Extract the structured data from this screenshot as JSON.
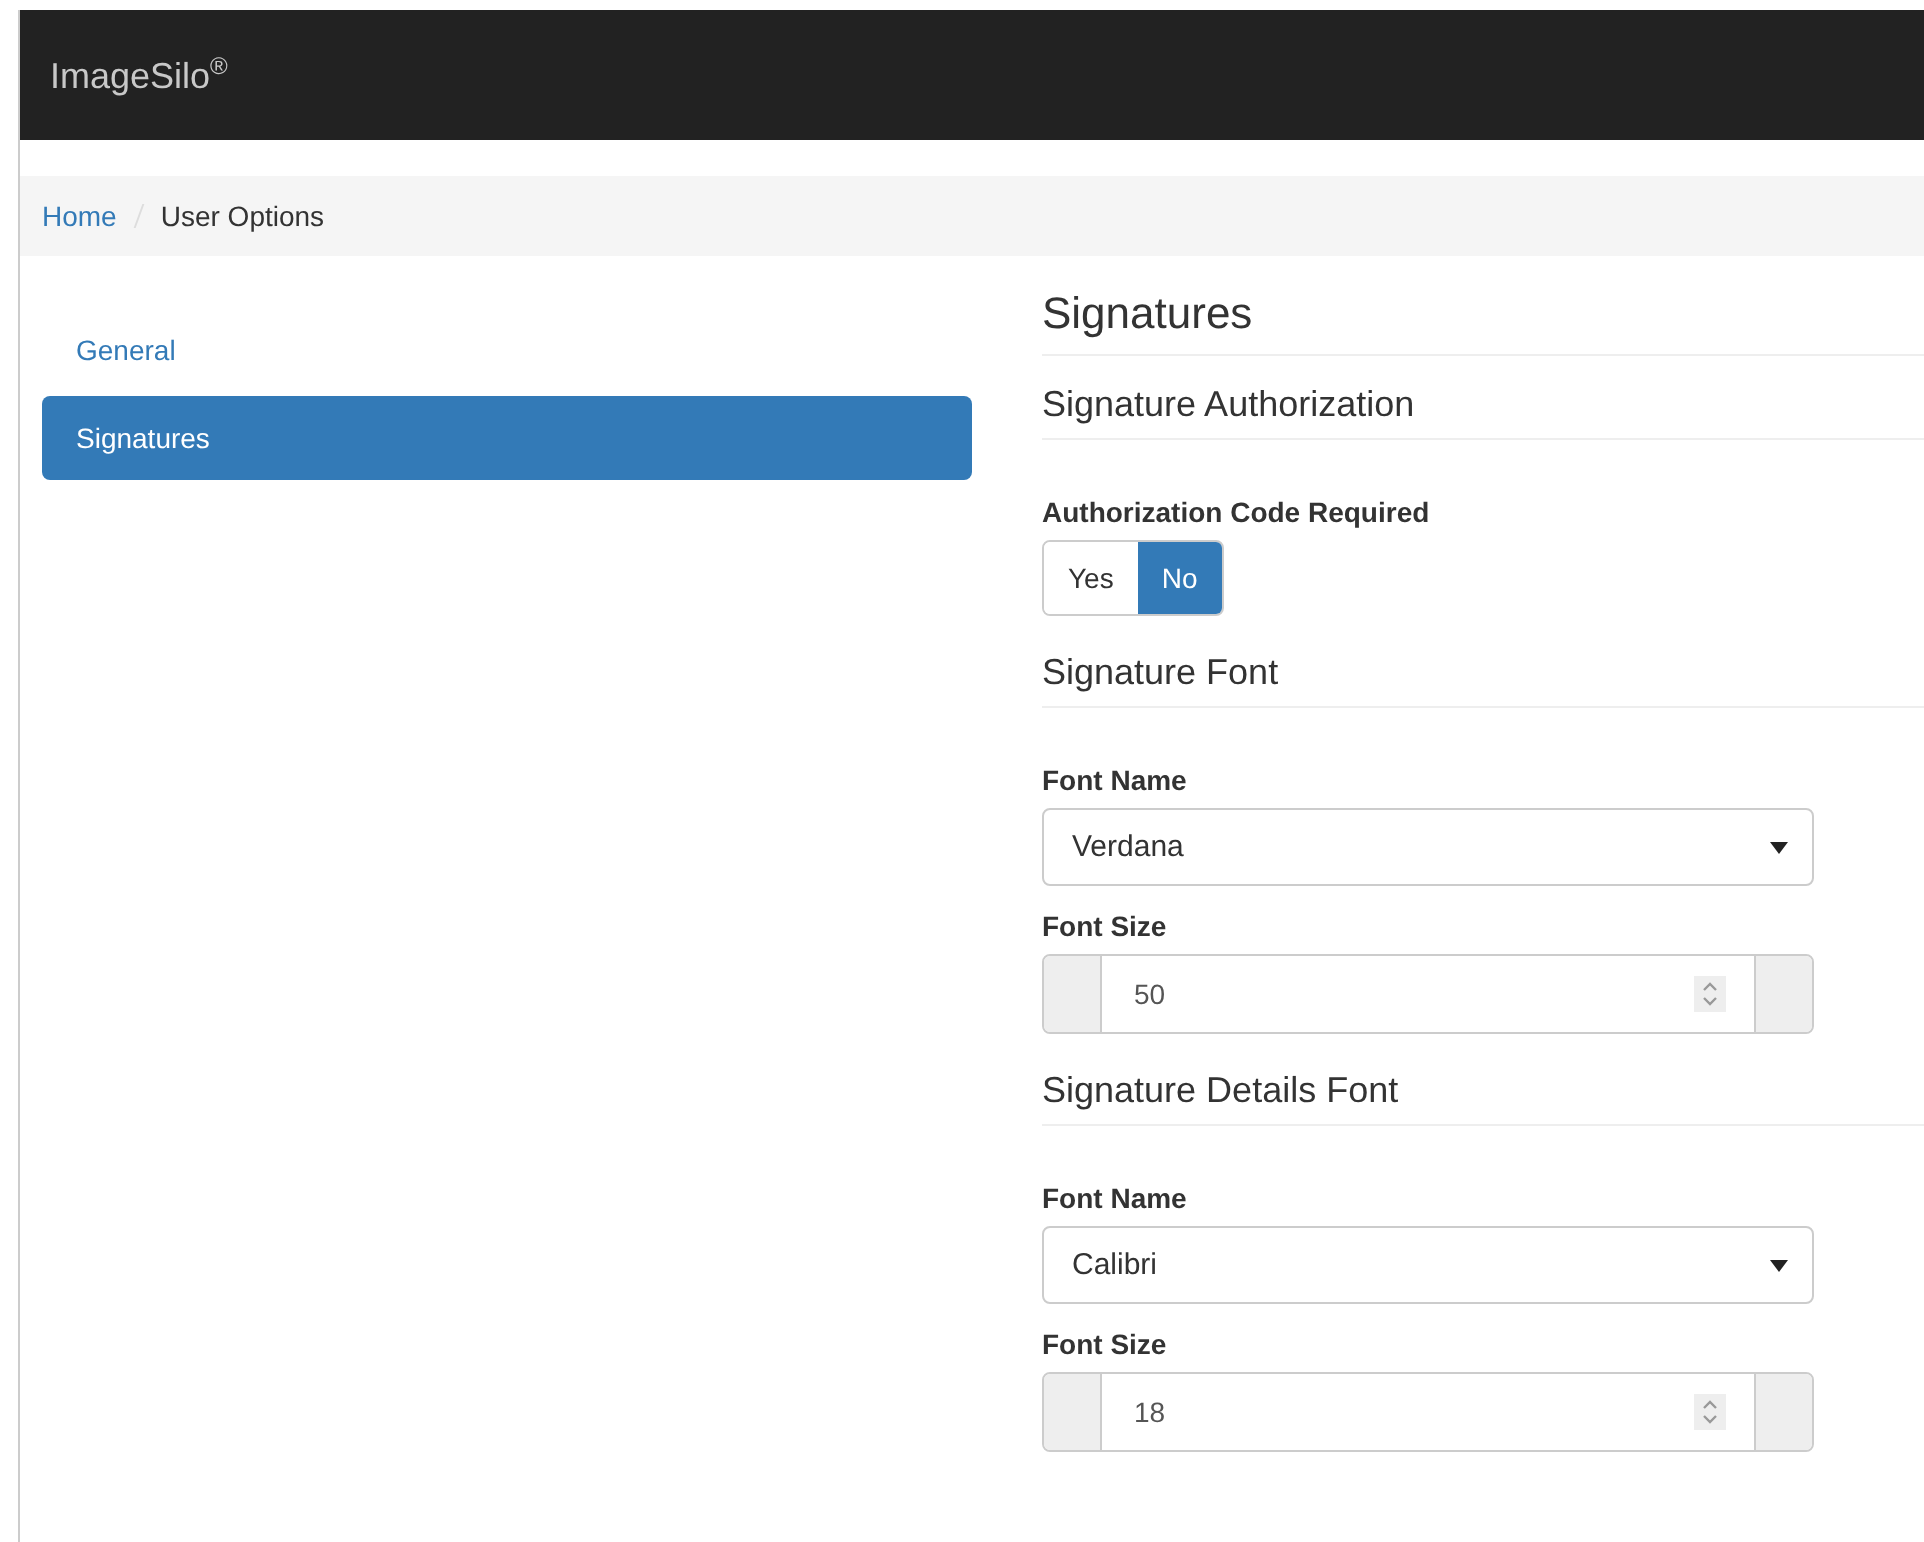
{
  "brand": "ImageSilo$^{®}$",
  "breadcrumb": [
    {
      "label": "Home",
      "current": false
    },
    {
      "label": "User Options",
      "current": true
    }
  ],
  "sidebar": {
    "items": [
      {
        "label": "General",
        "selected": false
      },
      {
        "label": "Signatures",
        "selected": true
      }
    ]
  },
  "page_title": "Signatures",
  "sections": [
    {
      "title": "Signature Authorization",
      "fields": [
        {
          "kind": "toggle",
          "label": "Authorization Code Required",
          "options": [
            {
              "label": "Yes",
              "selected": false
            },
            {
              "label": "No",
              "selected": true
            }
          ]
        }
      ]
    },
    {
      "title": "Signature Font",
      "fields": [
        {
          "kind": "select",
          "label": "Font Name",
          "value": "Verdana"
        },
        {
          "kind": "number",
          "label": "Font Size",
          "value": "50"
        }
      ]
    },
    {
      "title": "Signature Details Font",
      "fields": [
        {
          "kind": "select",
          "label": "Font Name",
          "value": "Calibri"
        },
        {
          "kind": "number",
          "label": "Font Size",
          "value": "18"
        }
      ]
    }
  ]
}
